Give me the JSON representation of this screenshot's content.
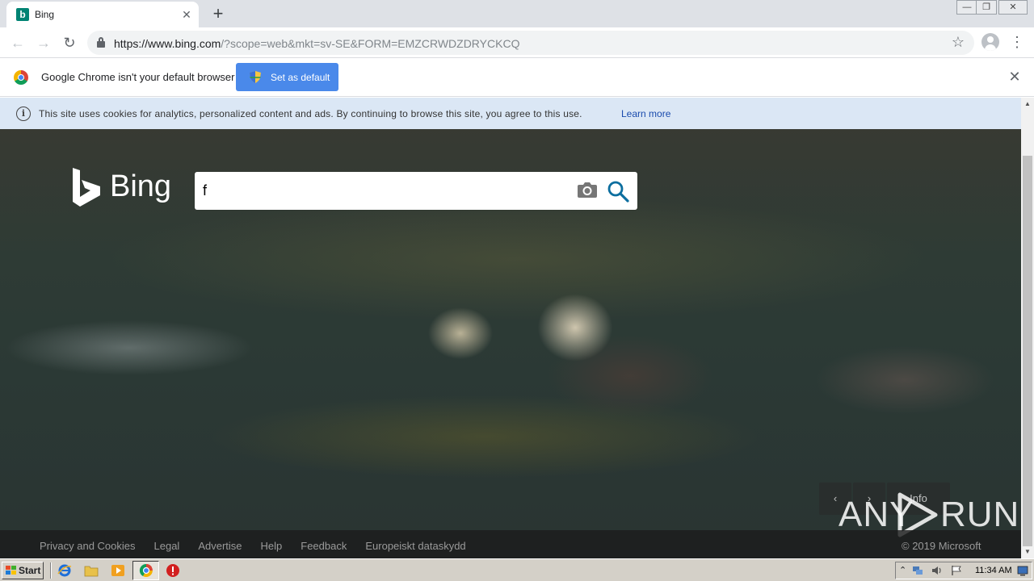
{
  "browser": {
    "tab": {
      "title": "Bing",
      "favicon_letter": "b"
    },
    "new_tab_symbol": "+",
    "url_host": "https://www.bing.com",
    "url_rest": "/?scope=web&mkt=sv-SE&FORM=EMZCRWDZDRYCKCQ",
    "infobar": {
      "message": "Google Chrome isn't your default browser",
      "button_label": "Set as default"
    }
  },
  "page": {
    "cookie_notice": {
      "text": "This site uses cookies for analytics, personalized content and ads. By continuing to browse this site, you agree to this use.",
      "link": "Learn more"
    },
    "logo_text": "Bing",
    "search": {
      "value": "f"
    },
    "carousel": {
      "info_label": "Info"
    },
    "footer": {
      "links": [
        "Privacy and Cookies",
        "Legal",
        "Advertise",
        "Help",
        "Feedback",
        "Europeiskt dataskydd"
      ],
      "copyright": "© 2019 Microsoft"
    },
    "watermark": {
      "left": "ANY",
      "right": "RUN"
    }
  },
  "taskbar": {
    "start_label": "Start",
    "clock": "11:34 AM"
  },
  "colors": {
    "accent_button": "#4a89ea",
    "bing_teal": "#008373",
    "cookie_bar": "#dbe7f5",
    "search_icon": "#0c6e9f"
  },
  "icons": [
    "bing-favicon-icon",
    "tab-close-icon",
    "back-icon",
    "forward-icon",
    "reload-icon",
    "lock-icon",
    "star-icon",
    "profile-icon",
    "menu-icon",
    "chrome-icon",
    "shield-icon",
    "close-icon",
    "info-icon",
    "camera-icon",
    "search-icon",
    "ie-icon",
    "folder-icon",
    "media-player-icon",
    "chrome-icon",
    "stop-icon"
  ]
}
